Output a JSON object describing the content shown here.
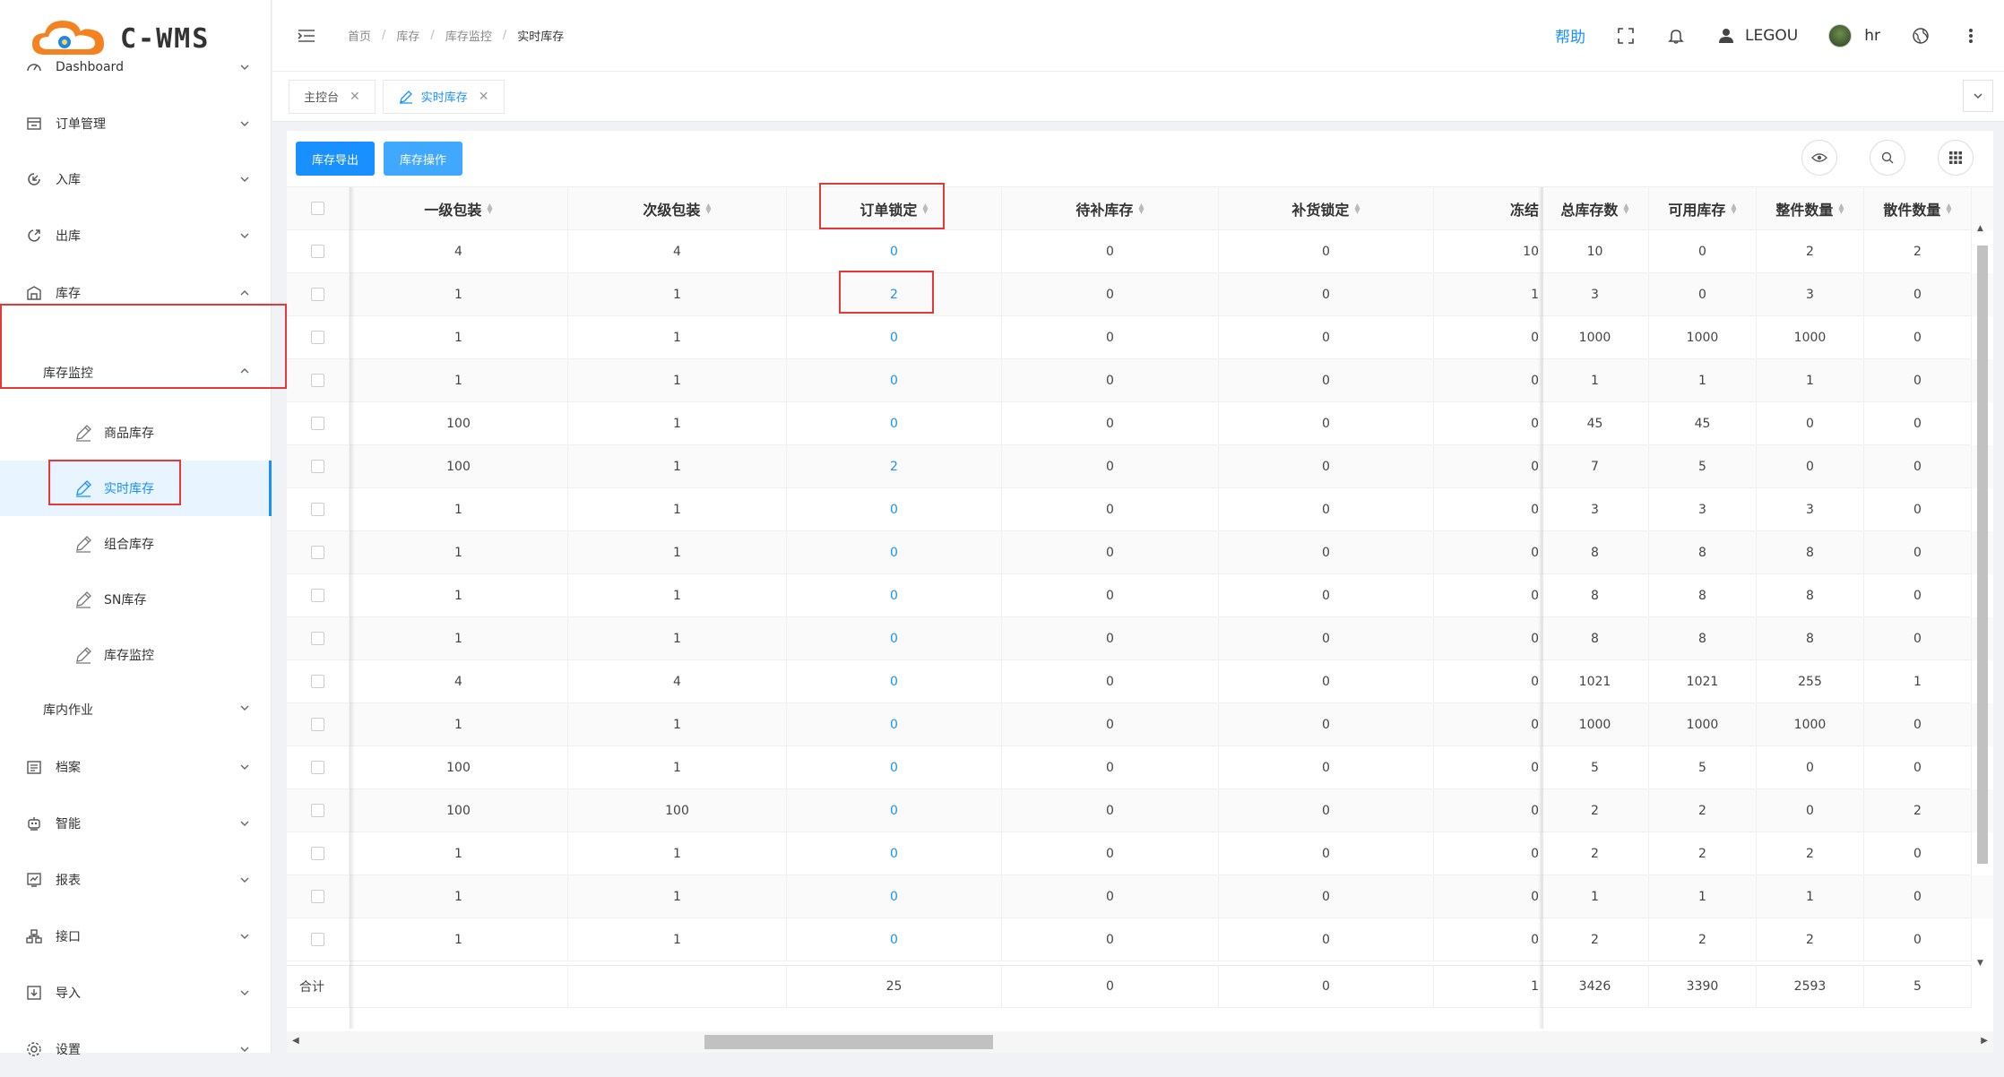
{
  "brand": {
    "name": "C-WMS"
  },
  "sidebar": {
    "items": [
      {
        "key": "dashboard",
        "label": "Dashboard",
        "icon": "dashboard-icon"
      },
      {
        "key": "orders",
        "label": "订单管理",
        "icon": "order-icon"
      },
      {
        "key": "inbound",
        "label": "入库",
        "icon": "inbound-icon"
      },
      {
        "key": "outbound",
        "label": "出库",
        "icon": "outbound-icon"
      },
      {
        "key": "inventory",
        "label": "库存",
        "icon": "warehouse-icon",
        "expanded": true
      }
    ],
    "inventory_sub": {
      "monitor_label": "库存监控",
      "leaves": [
        {
          "label": "商品库存",
          "icon": "pen-icon"
        },
        {
          "label": "实时库存",
          "icon": "pen-icon",
          "active": true
        },
        {
          "label": "组合库存",
          "icon": "pen-icon"
        },
        {
          "label": "SN库存",
          "icon": "pen-icon"
        },
        {
          "label": "库存监控",
          "icon": "pen-icon"
        }
      ],
      "inner_ops_label": "库内作业"
    },
    "bottom_items": [
      {
        "label": "档案",
        "icon": "archive-icon"
      },
      {
        "label": "智能",
        "icon": "robot-icon"
      },
      {
        "label": "报表",
        "icon": "report-icon"
      },
      {
        "label": "接口",
        "icon": "api-icon"
      },
      {
        "label": "导入",
        "icon": "import-icon"
      },
      {
        "label": "设置",
        "icon": "settings-icon"
      }
    ]
  },
  "header": {
    "breadcrumb": [
      "首页",
      "库存",
      "库存监控",
      "实时库存"
    ],
    "help_label": "帮助",
    "username": "LEGOU",
    "account": "hr"
  },
  "tabs": [
    {
      "label": "主控台",
      "active": false
    },
    {
      "label": "实时库存",
      "active": true
    }
  ],
  "toolbar": {
    "export_label": "库存导出",
    "operate_label": "库存操作"
  },
  "table": {
    "columns": [
      "一级包装",
      "次级包装",
      "订单锁定",
      "待补库存",
      "补货锁定",
      "冻结",
      "总库存数",
      "可用库存",
      "整件数量",
      "散件数量"
    ],
    "rows": [
      [
        "4",
        "4",
        "0",
        "0",
        "0",
        "10",
        "10",
        "0",
        "2",
        "2"
      ],
      [
        "1",
        "1",
        "2",
        "0",
        "0",
        "1",
        "3",
        "0",
        "3",
        "0"
      ],
      [
        "1",
        "1",
        "0",
        "0",
        "0",
        "0",
        "1000",
        "1000",
        "1000",
        "0"
      ],
      [
        "1",
        "1",
        "0",
        "0",
        "0",
        "0",
        "1",
        "1",
        "1",
        "0"
      ],
      [
        "100",
        "1",
        "0",
        "0",
        "0",
        "0",
        "45",
        "45",
        "0",
        "0"
      ],
      [
        "100",
        "1",
        "2",
        "0",
        "0",
        "0",
        "7",
        "5",
        "0",
        "0"
      ],
      [
        "1",
        "1",
        "0",
        "0",
        "0",
        "0",
        "3",
        "3",
        "3",
        "0"
      ],
      [
        "1",
        "1",
        "0",
        "0",
        "0",
        "0",
        "8",
        "8",
        "8",
        "0"
      ],
      [
        "1",
        "1",
        "0",
        "0",
        "0",
        "0",
        "8",
        "8",
        "8",
        "0"
      ],
      [
        "1",
        "1",
        "0",
        "0",
        "0",
        "0",
        "8",
        "8",
        "8",
        "0"
      ],
      [
        "4",
        "4",
        "0",
        "0",
        "0",
        "0",
        "1021",
        "1021",
        "255",
        "1"
      ],
      [
        "1",
        "1",
        "0",
        "0",
        "0",
        "0",
        "1000",
        "1000",
        "1000",
        "0"
      ],
      [
        "100",
        "1",
        "0",
        "0",
        "0",
        "0",
        "5",
        "5",
        "0",
        "0"
      ],
      [
        "100",
        "100",
        "0",
        "0",
        "0",
        "0",
        "2",
        "2",
        "0",
        "2"
      ],
      [
        "1",
        "1",
        "0",
        "0",
        "0",
        "0",
        "2",
        "2",
        "2",
        "0"
      ],
      [
        "1",
        "1",
        "0",
        "0",
        "0",
        "0",
        "1",
        "1",
        "1",
        "0"
      ],
      [
        "1",
        "1",
        "0",
        "0",
        "0",
        "0",
        "2",
        "2",
        "2",
        "0"
      ]
    ],
    "footer": {
      "label": "合计",
      "values": [
        "",
        "",
        "25",
        "0",
        "0",
        "1",
        "3426",
        "3390",
        "2593",
        "5"
      ]
    }
  },
  "colors": {
    "accent": "#1890ff",
    "highlight_box": "#e53935"
  }
}
